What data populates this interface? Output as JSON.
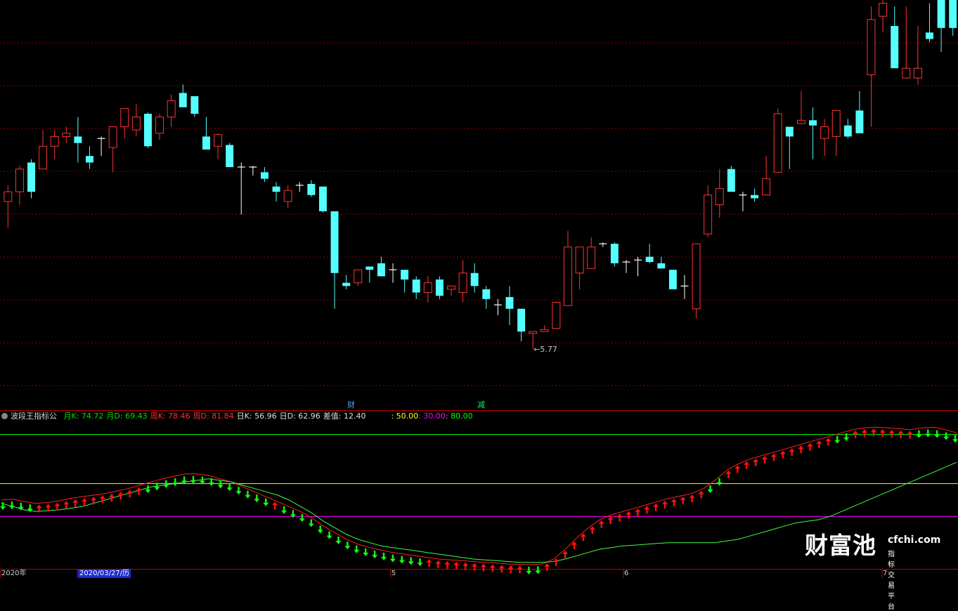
{
  "chart_data": [
    {
      "type": "candlestick",
      "title": "",
      "low_marker": "←5.77",
      "tags": {
        "cai": "财",
        "jian": "减"
      },
      "candles": [
        [
          8.45,
          8.7,
          8.05,
          8.6
        ],
        [
          8.6,
          9.0,
          8.4,
          8.95
        ],
        [
          9.05,
          9.1,
          8.5,
          8.6
        ],
        [
          8.95,
          9.55,
          8.95,
          9.3
        ],
        [
          9.3,
          9.55,
          9.1,
          9.45
        ],
        [
          9.45,
          9.6,
          9.35,
          9.5
        ],
        [
          9.45,
          9.75,
          9.05,
          9.35
        ],
        [
          9.15,
          9.3,
          8.95,
          9.05
        ],
        [
          9.4,
          9.45,
          9.15,
          9.42
        ],
        [
          9.28,
          9.6,
          8.9,
          9.6
        ],
        [
          9.6,
          9.88,
          9.42,
          9.88
        ],
        [
          9.55,
          9.95,
          9.45,
          9.75
        ],
        [
          9.8,
          9.82,
          9.27,
          9.3
        ],
        [
          9.5,
          9.8,
          9.4,
          9.75
        ],
        [
          9.75,
          10.1,
          9.6,
          10.0
        ],
        [
          10.12,
          10.25,
          9.9,
          9.9
        ],
        [
          10.07,
          10.05,
          9.75,
          9.8
        ],
        [
          9.45,
          9.75,
          9.25,
          9.25
        ],
        [
          9.3,
          9.5,
          9.1,
          9.48
        ],
        [
          9.32,
          9.35,
          8.98,
          8.98
        ],
        [
          8.98,
          9.05,
          8.25,
          8.98
        ],
        [
          8.98,
          9.0,
          8.85,
          8.98
        ],
        [
          8.9,
          8.98,
          8.75,
          8.8
        ],
        [
          8.68,
          8.75,
          8.45,
          8.6
        ],
        [
          8.45,
          8.7,
          8.35,
          8.62
        ],
        [
          8.7,
          8.75,
          8.6,
          8.7
        ],
        [
          8.72,
          8.78,
          8.52,
          8.55
        ],
        [
          8.68,
          8.68,
          8.28,
          8.3
        ],
        [
          8.3,
          8.3,
          6.8,
          7.35
        ],
        [
          7.2,
          7.32,
          7.1,
          7.15
        ],
        [
          7.2,
          7.4,
          7.15,
          7.4
        ],
        [
          7.45,
          7.45,
          7.2,
          7.4
        ],
        [
          7.5,
          7.6,
          7.3,
          7.3
        ],
        [
          7.4,
          7.5,
          7.2,
          7.4
        ],
        [
          7.4,
          7.4,
          7.05,
          7.25
        ],
        [
          7.25,
          7.3,
          6.95,
          7.05
        ],
        [
          7.05,
          7.3,
          6.9,
          7.2
        ],
        [
          7.25,
          7.3,
          6.95,
          7.0
        ],
        [
          7.1,
          7.15,
          7.0,
          7.15
        ],
        [
          7.05,
          7.55,
          6.9,
          7.35
        ],
        [
          7.35,
          7.5,
          7.05,
          7.15
        ],
        [
          7.1,
          7.15,
          6.8,
          6.95
        ],
        [
          6.85,
          6.95,
          6.7,
          6.86
        ],
        [
          6.98,
          7.15,
          6.55,
          6.8
        ],
        [
          6.8,
          6.8,
          6.3,
          6.45
        ],
        [
          6.42,
          6.42,
          6.18,
          6.45
        ],
        [
          6.45,
          6.55,
          6.45,
          6.48
        ],
        [
          6.5,
          6.9,
          6.5,
          6.9
        ],
        [
          6.85,
          8.0,
          6.85,
          7.75
        ],
        [
          7.35,
          7.75,
          7.1,
          7.75
        ],
        [
          7.42,
          7.9,
          7.42,
          7.75
        ],
        [
          7.8,
          7.82,
          7.75,
          7.8
        ],
        [
          7.8,
          7.82,
          7.45,
          7.5
        ],
        [
          7.5,
          7.55,
          7.35,
          7.52
        ],
        [
          7.55,
          7.6,
          7.3,
          7.55
        ],
        [
          7.6,
          7.8,
          7.5,
          7.52
        ],
        [
          7.5,
          7.6,
          7.42,
          7.42
        ],
        [
          7.4,
          7.4,
          7.1,
          7.1
        ],
        [
          7.15,
          7.32,
          6.95,
          7.15
        ],
        [
          6.8,
          7.65,
          6.65,
          7.8
        ],
        [
          7.95,
          8.7,
          7.9,
          8.55
        ],
        [
          8.4,
          8.95,
          8.2,
          8.65
        ],
        [
          8.95,
          9.0,
          8.6,
          8.6
        ],
        [
          8.55,
          8.6,
          8.3,
          8.55
        ],
        [
          8.55,
          8.65,
          8.45,
          8.5
        ],
        [
          8.55,
          9.15,
          8.55,
          8.8
        ],
        [
          8.9,
          9.88,
          8.9,
          9.8
        ],
        [
          9.6,
          9.5,
          8.95,
          9.45
        ],
        [
          9.65,
          10.15,
          9.65,
          9.7
        ],
        [
          9.7,
          9.9,
          9.1,
          9.62
        ],
        [
          9.42,
          9.72,
          9.15,
          9.6
        ],
        [
          9.45,
          9.55,
          9.15,
          9.85
        ],
        [
          9.62,
          9.72,
          9.42,
          9.45
        ],
        [
          9.85,
          10.15,
          9.75,
          9.5
        ],
        [
          10.4,
          11.45,
          9.6,
          11.25
        ],
        [
          11.3,
          11.55,
          11.05,
          11.5
        ],
        [
          11.15,
          11.45,
          10.95,
          10.5
        ],
        [
          10.35,
          11.45,
          10.45,
          10.5
        ],
        [
          10.35,
          11.15,
          10.25,
          10.5
        ],
        [
          11.05,
          11.5,
          10.9,
          10.95
        ],
        [
          11.62,
          11.62,
          10.75,
          11.12
        ],
        [
          11.62,
          11.5,
          11.0,
          11.12
        ]
      ],
      "price_range": [
        5.5,
        11.55
      ],
      "grid": "dotted red horizontals"
    },
    {
      "type": "line",
      "title": "波段王指标公",
      "readout": [
        {
          "label": "月K:",
          "value": "74.72",
          "color": "#00dd00"
        },
        {
          "label": "月D:",
          "value": "69.43",
          "color": "#00dd00"
        },
        {
          "label": "周K:",
          "value": "78.46",
          "color": "#ff3030"
        },
        {
          "label": "周D:",
          "value": "81.84",
          "color": "#ff3030"
        },
        {
          "label": "日K:",
          "value": "56.96",
          "color": "#dddddd"
        },
        {
          "label": "日D:",
          "value": "62.96",
          "color": "#dddddd"
        },
        {
          "label": "差值:",
          "value": "12.40",
          "color": "#dddddd"
        }
      ],
      "levels": [
        {
          "label": ": 50.00",
          "value": 50,
          "color": "#ffff00"
        },
        {
          "label": ": 30.00",
          "value": 30,
          "color": "#ff00ff"
        },
        {
          "label": ": 80.00",
          "value": 80,
          "color": "#00ff00"
        }
      ],
      "ylim": [
        -2,
        88
      ],
      "red_line": [
        40,
        40.5,
        39,
        38,
        38.5,
        39.5,
        41,
        42,
        43,
        44,
        45.5,
        47,
        49,
        51,
        53,
        54.5,
        56,
        56,
        55,
        53,
        51,
        48,
        45,
        42,
        39,
        36,
        33,
        29,
        24,
        20,
        16,
        13,
        11,
        9.5,
        8,
        7,
        6,
        5,
        4,
        3.5,
        3,
        2.5,
        2,
        1.5,
        1,
        0.8,
        0.6,
        1,
        4,
        10,
        17,
        23,
        28,
        31,
        33,
        35,
        37,
        39,
        41,
        42.5,
        44,
        47,
        52,
        58,
        62,
        65,
        67,
        69,
        71,
        73,
        75,
        77,
        79,
        81,
        83,
        84,
        84.5,
        84,
        83.5,
        83,
        84,
        84.5,
        83,
        81
      ],
      "green_line": [
        38,
        36,
        34,
        33,
        33.5,
        34,
        35,
        36,
        38,
        40,
        42,
        44,
        46,
        48,
        49,
        50,
        51,
        52,
        53,
        52,
        51,
        49,
        47,
        45,
        43,
        40,
        36,
        32,
        27,
        23,
        19,
        16,
        14,
        12,
        11,
        10,
        9,
        8,
        7,
        6,
        5,
        4,
        3.5,
        3,
        2.5,
        2,
        2,
        2,
        2.5,
        4,
        6,
        8,
        10,
        11,
        12,
        12.5,
        13,
        13.5,
        14,
        14,
        14,
        14,
        14,
        15,
        16,
        18,
        20,
        22,
        24,
        26,
        27,
        28,
        30,
        33,
        36,
        39,
        42,
        45,
        48,
        51,
        54,
        57,
        60,
        63
      ],
      "arrows": [
        "d",
        "d",
        "d",
        "d",
        "u",
        "u",
        "u",
        "u",
        "u",
        "u",
        "u",
        "u",
        "u",
        "u",
        "u",
        "u",
        "d",
        "d",
        "d",
        "d",
        "d",
        "d",
        "d",
        "d",
        "d",
        "d",
        "d",
        "d",
        "d",
        "d",
        "u",
        "d",
        "d",
        "d",
        "d",
        "d",
        "d",
        "d",
        "d",
        "d",
        "d",
        "d",
        "d",
        "d",
        "d",
        "d",
        "d",
        "u",
        "u",
        "u",
        "u",
        "u",
        "u",
        "u",
        "u",
        "u",
        "u",
        "u",
        "d",
        "d",
        "u",
        "u",
        "u",
        "u",
        "u",
        "u",
        "u",
        "u",
        "u",
        "u",
        "u",
        "u",
        "u",
        "u",
        "u",
        "u",
        "u",
        "u",
        "d",
        "d",
        "u",
        "u",
        "u",
        "u",
        "u",
        "u",
        "u",
        "u",
        "u",
        "u",
        "u",
        "u",
        "d",
        "d",
        "u",
        "u",
        "u",
        "u",
        "u",
        "u",
        "u",
        "d",
        "d",
        "d",
        "d",
        "d"
      ],
      "x_labels": [
        {
          "text": "2020年",
          "pos": 0.0
        },
        {
          "text": "2020/03/27/历",
          "pos": 0.08
        },
        {
          "text": "5",
          "pos": 0.407
        },
        {
          "text": "6",
          "pos": 0.65
        },
        {
          "text": "7",
          "pos": 0.92
        }
      ]
    }
  ],
  "watermark": {
    "brand": "财富池",
    "url": "cfchi.com",
    "tagline": "指标交易平台"
  }
}
